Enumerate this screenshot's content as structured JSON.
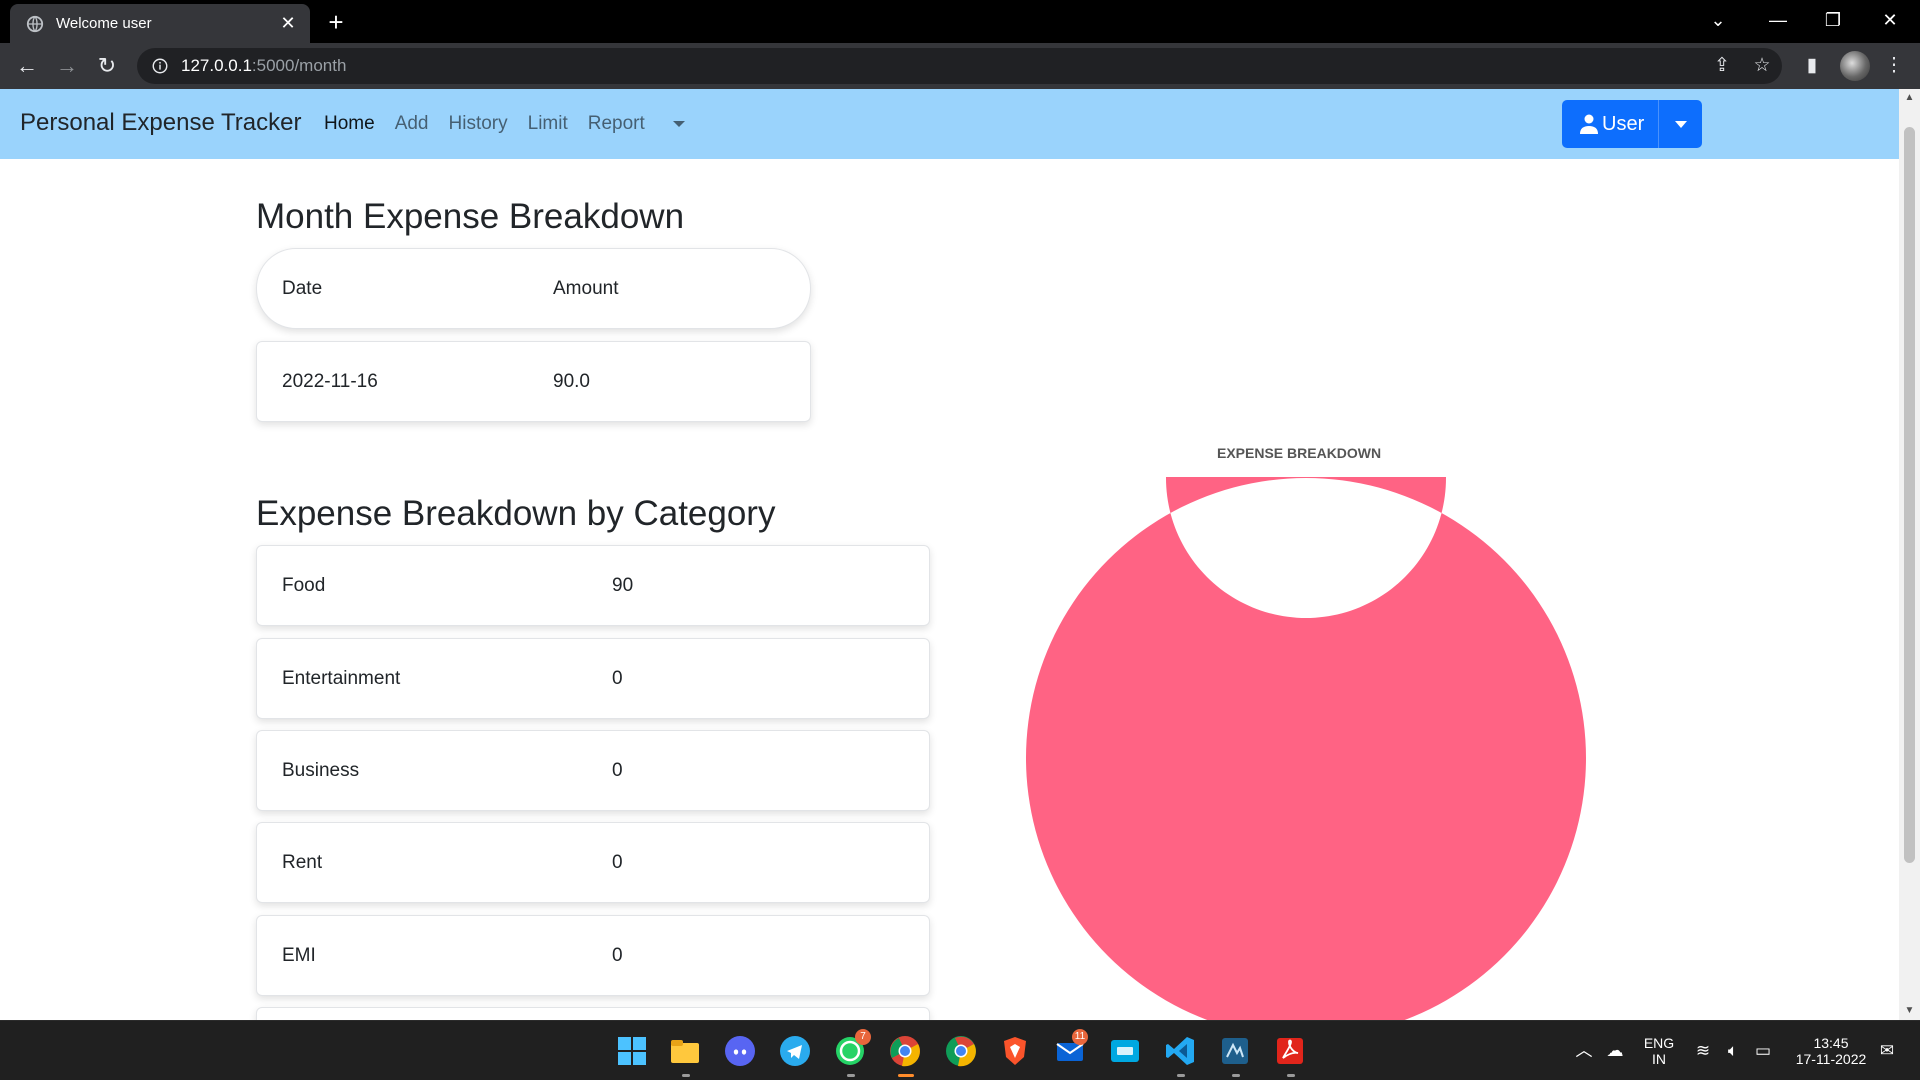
{
  "browser": {
    "tab_title": "Welcome user",
    "url_host": "127.0.0.1",
    "url_path": ":5000/month"
  },
  "navbar": {
    "brand": "Personal Expense Tracker",
    "links": [
      {
        "label": "Home",
        "active": true
      },
      {
        "label": "Add",
        "active": false
      },
      {
        "label": "History",
        "active": false
      },
      {
        "label": "Limit",
        "active": false
      },
      {
        "label": "Report",
        "active": false,
        "dropdown": true
      }
    ],
    "user_button": "User"
  },
  "month_breakdown": {
    "title": "Month Expense Breakdown",
    "headers": [
      "Date",
      "Amount"
    ],
    "rows": [
      {
        "date": "2022-11-16",
        "amount": "90.0"
      }
    ]
  },
  "category_breakdown": {
    "title": "Expense Breakdown by Category",
    "rows": [
      {
        "category": "Food",
        "amount": "90"
      },
      {
        "category": "Entertainment",
        "amount": "0"
      },
      {
        "category": "Business",
        "amount": "0"
      },
      {
        "category": "Rent",
        "amount": "0"
      },
      {
        "category": "EMI",
        "amount": "0"
      }
    ]
  },
  "chart_data": {
    "type": "pie",
    "title": "EXPENSE BREAKDOWN",
    "categories": [
      "Food",
      "Entertainment",
      "Business",
      "Rent",
      "EMI"
    ],
    "values": [
      90,
      0,
      0,
      0,
      0
    ],
    "colors": [
      "#ff6384",
      "#36a2eb",
      "#ffce56",
      "#4bc0c0",
      "#9966ff"
    ],
    "donut": true
  },
  "taskbar": {
    "whatsapp_badge": "7",
    "mail_badge": "11",
    "lang_top": "ENG",
    "lang_bottom": "IN",
    "time": "13:45",
    "date": "17-11-2022"
  },
  "colors": {
    "navbar_bg": "#9ad3fc",
    "primary": "#0d6efd",
    "chart_slice": "#ff6384"
  }
}
